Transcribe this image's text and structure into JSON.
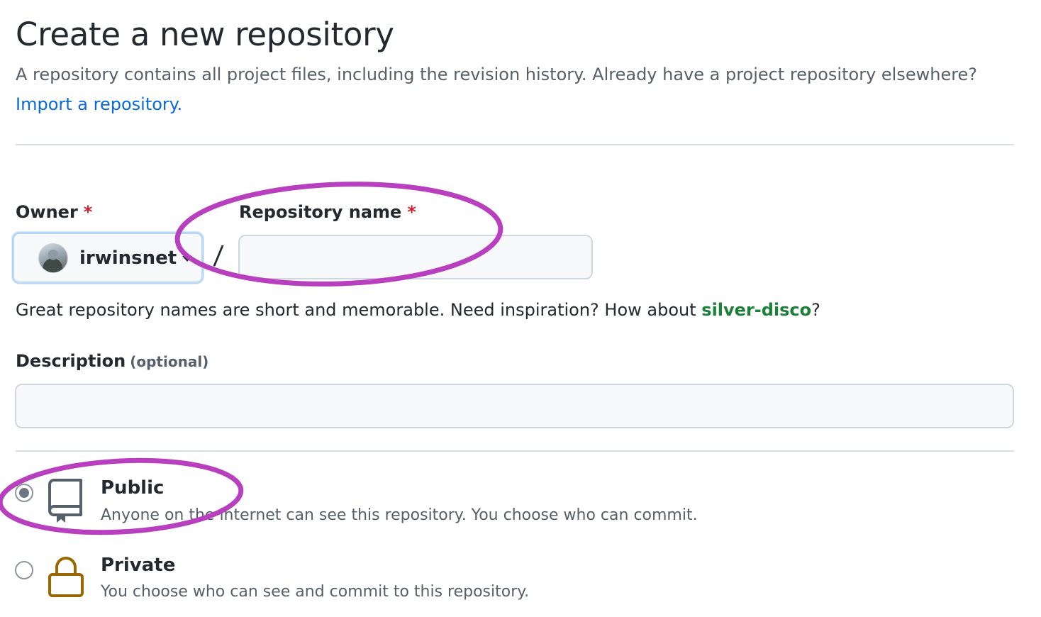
{
  "page": {
    "title": "Create a new repository",
    "subtitle": "A repository contains all project files, including the revision history. Already have a project repository elsewhere?",
    "import_link": "Import a repository."
  },
  "owner": {
    "label": "Owner",
    "required_mark": "*",
    "selected": "irwinsnet"
  },
  "separator": "/",
  "repo_name": {
    "label": "Repository name",
    "required_mark": "*",
    "value": "",
    "placeholder": ""
  },
  "name_hint": {
    "text": "Great repository names are short and memorable. Need inspiration? How about ",
    "suggestion": "silver-disco",
    "suffix": "?"
  },
  "description": {
    "label": "Description",
    "optional_note": "(optional)",
    "value": "",
    "placeholder": ""
  },
  "visibility": {
    "options": [
      {
        "title": "Public",
        "description": "Anyone on the internet can see this repository. You choose who can commit.",
        "selected": true,
        "icon": "repo-icon"
      },
      {
        "title": "Private",
        "description": "You choose who can see and commit to this repository.",
        "selected": false,
        "icon": "lock-icon"
      }
    ]
  },
  "colors": {
    "link": "#0969da",
    "suggestion": "#1a7f37",
    "required": "#cf222e",
    "annotation": "#b83fbe",
    "lock": "#9a6700"
  }
}
